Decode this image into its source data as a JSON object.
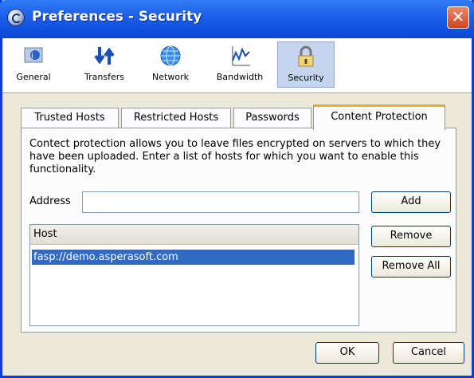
{
  "window": {
    "title": "Preferences - Security"
  },
  "toolbar": {
    "items": [
      {
        "label": "General",
        "icon": "general-icon"
      },
      {
        "label": "Transfers",
        "icon": "transfers-icon"
      },
      {
        "label": "Network",
        "icon": "globe-icon"
      },
      {
        "label": "Bandwidth",
        "icon": "bandwidth-icon"
      },
      {
        "label": "Security",
        "icon": "lock-icon",
        "active": true
      }
    ]
  },
  "tabs": [
    {
      "label": "Trusted Hosts"
    },
    {
      "label": "Restricted Hosts"
    },
    {
      "label": "Passwords"
    },
    {
      "label": "Content Protection",
      "active": true
    }
  ],
  "content": {
    "description": "Contect protection allows you to leave files encrypted on servers to which they have been uploaded.  Enter a list of hosts for which you want to enable this functionality.",
    "address_label": "Address",
    "address_value": "",
    "add_label": "Add",
    "remove_label": "Remove",
    "remove_all_label": "Remove All",
    "hosts_header": "Host",
    "hosts": [
      "fasp://demo.asperasoft.com"
    ]
  },
  "footer": {
    "ok_label": "OK",
    "cancel_label": "Cancel"
  },
  "colors": {
    "titlebar": "#0a47d8",
    "selection": "#316ac5",
    "active_tab_accent": "#f5a82a"
  }
}
